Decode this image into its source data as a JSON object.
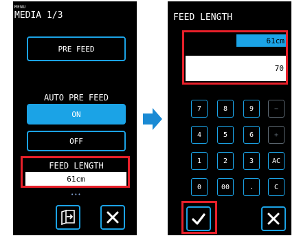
{
  "left": {
    "menu_small": "MENU",
    "menu_title": "MEDIA 1/3",
    "pre_feed_button": "PRE FEED",
    "auto_pre_feed_label": "AUTO PRE FEED",
    "on_button": "ON",
    "off_button": "OFF",
    "feed_length_label": "FEED LENGTH",
    "feed_length_value": "61cm",
    "page_dots": "•••",
    "icons": {
      "load_media": "media-load-icon",
      "close": "close-icon"
    }
  },
  "right": {
    "title": "FEED LENGTH",
    "current_value": "61cm",
    "input_value": "70",
    "keypad": {
      "row1": [
        "7",
        "8",
        "9",
        "−"
      ],
      "row2": [
        "4",
        "5",
        "6",
        "+"
      ],
      "row3": [
        "1",
        "2",
        "3",
        "AC"
      ],
      "row4": [
        "0",
        "00",
        ".",
        "C"
      ]
    },
    "icons": {
      "confirm": "checkmark-icon",
      "close": "close-icon"
    }
  },
  "colors": {
    "accent": "#1ba3e6",
    "highlight": "#e8202a",
    "screen": "#000000",
    "disabled": "#5b6670"
  },
  "transition_icon": "arrow-right-icon"
}
